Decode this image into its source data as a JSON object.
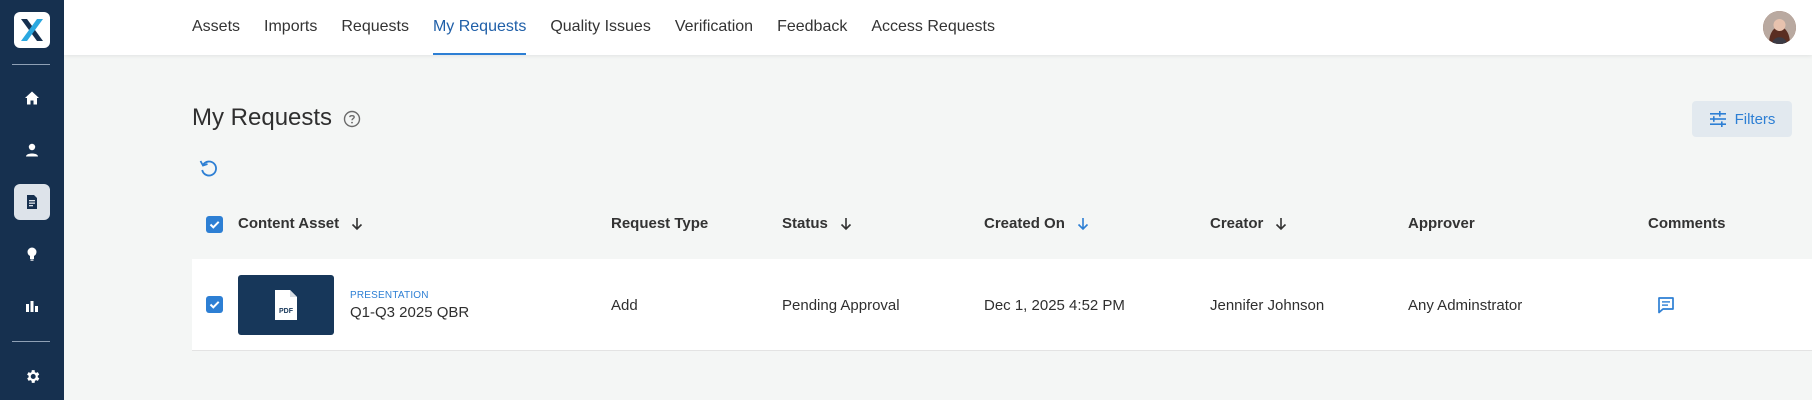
{
  "sidebar": {
    "logo": "X",
    "items": [
      {
        "icon": "home-icon"
      },
      {
        "icon": "user-icon"
      },
      {
        "icon": "document-icon",
        "active": true
      },
      {
        "icon": "lightbulb-icon"
      },
      {
        "icon": "bar-chart-icon"
      },
      {
        "icon": "gear-icon"
      }
    ]
  },
  "nav": {
    "tabs": [
      {
        "label": "Assets"
      },
      {
        "label": "Imports"
      },
      {
        "label": "Requests"
      },
      {
        "label": "My Requests",
        "active": true
      },
      {
        "label": "Quality Issues"
      },
      {
        "label": "Verification"
      },
      {
        "label": "Feedback"
      },
      {
        "label": "Access Requests"
      }
    ]
  },
  "page": {
    "title": "My Requests",
    "filters_label": "Filters"
  },
  "table": {
    "columns": {
      "content_asset": "Content Asset",
      "request_type": "Request Type",
      "status": "Status",
      "created_on": "Created On",
      "creator": "Creator",
      "approver": "Approver",
      "comments": "Comments"
    },
    "rows": [
      {
        "checked": true,
        "thumb_label": "PDF",
        "asset_type": "PRESENTATION",
        "asset_name": "Q1-Q3 2025 QBR",
        "request_type": "Add",
        "status": "Pending Approval",
        "created_on": "Dec 1, 2025 4:52 PM",
        "creator": "Jennifer Johnson",
        "approver": "Any Adminstrator"
      }
    ]
  },
  "colors": {
    "sidebar_bg": "#16304f",
    "accent": "#2d7fd4",
    "page_bg": "#f4f6f5"
  }
}
